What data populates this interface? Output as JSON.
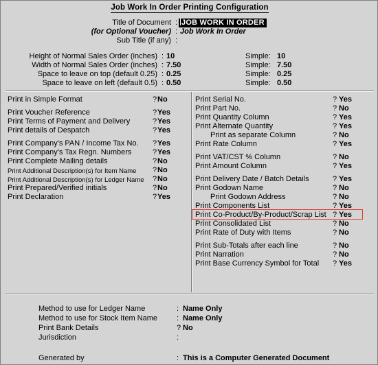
{
  "screen": {
    "title": "Job Work In Order Printing Configuration"
  },
  "header": {
    "rows": [
      {
        "label": "Title of Document",
        "sep": ":",
        "value": "JOB WORK IN ORDER",
        "style": "highlight"
      },
      {
        "label": "(for Optional Voucher)",
        "sep": ":",
        "value": "Job Work In Order",
        "style": "italic"
      },
      {
        "label": "Sub Title (if any)",
        "sep": ":",
        "value": ""
      }
    ],
    "numeric_rows": [
      {
        "label": "Height of Normal Sales Order (inches)",
        "sep": ":",
        "value": "10",
        "simple_label": "Simple:",
        "simple_value": "10"
      },
      {
        "label": "Width of Normal Sales Order (inches)",
        "sep": ":",
        "value": "7.50",
        "simple_label": "Simple:",
        "simple_value": "7.50"
      },
      {
        "label": "Space to leave on top (default 0.25)",
        "sep": ":",
        "value": "0.25",
        "simple_label": "Simple:",
        "simple_value": "0.25"
      },
      {
        "label": "Space to leave on left (default 0.5)",
        "sep": ":",
        "value": "0.50",
        "simple_label": "Simple:",
        "simple_value": "0.50"
      }
    ]
  },
  "left_column": {
    "options": [
      {
        "label": "Print in Simple Format",
        "q": "?",
        "value": "No"
      },
      {
        "label": "Print Voucher Reference",
        "q": "?",
        "value": "Yes",
        "gap": true
      },
      {
        "label": "Print Terms of Payment and Delivery",
        "q": "?",
        "value": "Yes"
      },
      {
        "label": "Print details of Despatch",
        "q": "?",
        "value": "Yes"
      },
      {
        "label": "Print Company's PAN / Income Tax No.",
        "q": "?",
        "value": "Yes",
        "gap": true
      },
      {
        "label": "Print Company's Tax Regn. Numbers",
        "q": "?",
        "value": "Yes"
      },
      {
        "label": "Print Complete Mailing details",
        "q": "?",
        "value": "No"
      },
      {
        "label": "Print Additional Description(s) for Item Name",
        "q": "?",
        "value": "No",
        "small": true
      },
      {
        "label": "Print Additional Description(s) for Ledger Name",
        "q": "?",
        "value": "No",
        "small": true
      },
      {
        "label": "Print Prepared/Verified initials",
        "q": "?",
        "value": "No"
      },
      {
        "label": "Print Declaration",
        "q": "?",
        "value": "Yes"
      }
    ]
  },
  "right_column": {
    "options": [
      {
        "label": "Print Serial No.",
        "q": "?",
        "value": "Yes"
      },
      {
        "label": "Print Part No.",
        "q": "?",
        "value": "No"
      },
      {
        "label": "Print Quantity Column",
        "q": "?",
        "value": "Yes"
      },
      {
        "label": "Print Alternate Quantity",
        "q": "?",
        "value": "Yes"
      },
      {
        "label": "Print as separate Column",
        "q": "?",
        "value": "No",
        "indent": true
      },
      {
        "label": "Print Rate Column",
        "q": "?",
        "value": "Yes"
      },
      {
        "label": "Print VAT/CST % Column",
        "q": "?",
        "value": "No",
        "gap": true
      },
      {
        "label": "Print Amount Column",
        "q": "?",
        "value": "Yes"
      },
      {
        "label": "Print Delivery Date / Batch Details",
        "q": "?",
        "value": "Yes",
        "gap": true
      },
      {
        "label": "Print Godown Name",
        "q": "?",
        "value": "No"
      },
      {
        "label": "Print Godown Address",
        "q": "?",
        "value": "No",
        "indent": true
      },
      {
        "label": "Print Components List",
        "q": "?",
        "value": "Yes"
      },
      {
        "label": "Print Co-Product/By-Product/Scrap List",
        "q": "?",
        "value": "Yes",
        "highlighted": true
      },
      {
        "label": "Print Consolidated List",
        "q": "?",
        "value": "No"
      },
      {
        "label": "Print Rate of Duty with Items",
        "q": "?",
        "value": "No"
      },
      {
        "label": "Print Sub-Totals after each line",
        "q": "?",
        "value": "No",
        "gap": true
      },
      {
        "label": "Print Narration",
        "q": "?",
        "value": "No"
      },
      {
        "label": "Print Base Currency Symbol for Total",
        "q": "?",
        "value": "Yes"
      }
    ]
  },
  "footer": {
    "rows": [
      {
        "label": "Method to use for Ledger Name",
        "sep": ":",
        "value": "Name Only"
      },
      {
        "label": "Method to use for Stock Item Name",
        "sep": ":",
        "value": "Name Only"
      },
      {
        "label": "Print Bank Details",
        "sep": "?",
        "value": "No"
      },
      {
        "label": "Jurisdiction",
        "sep": ":",
        "value": ""
      },
      {
        "label": "Generated by",
        "sep": ":",
        "value": "This is a Computer Generated Document",
        "spacer_before": true
      }
    ]
  },
  "colors": {
    "background": "#d4d4d4",
    "highlight_field_bg": "#000000",
    "highlight_field_fg": "#ffffff",
    "selection_box": "#e03a30",
    "divider": "#777777"
  }
}
